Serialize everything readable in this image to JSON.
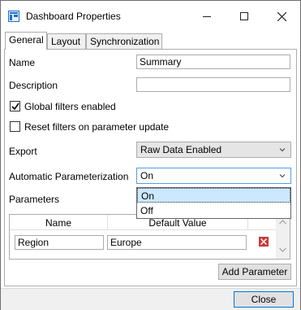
{
  "window": {
    "title": "Dashboard Properties"
  },
  "tabs": [
    {
      "label": "General",
      "active": true
    },
    {
      "label": "Layout",
      "active": false
    },
    {
      "label": "Synchronization",
      "active": false
    }
  ],
  "general": {
    "name_label": "Name",
    "name_value": "Summary",
    "description_label": "Description",
    "description_value": "",
    "global_filters_label": "Global filters enabled",
    "global_filters_checked": true,
    "reset_filters_label": "Reset filters on parameter update",
    "reset_filters_checked": false,
    "export_label": "Export",
    "export_value": "Raw Data Enabled",
    "auto_param_label": "Automatic Parameterization",
    "auto_param_value": "On",
    "auto_param_options": [
      "On",
      "Off"
    ],
    "auto_param_highlighted": "On",
    "parameters_label": "Parameters"
  },
  "parameters_grid": {
    "columns": [
      "Name",
      "Default Value"
    ],
    "rows": [
      {
        "name": "Region",
        "default_value": "Europe"
      }
    ]
  },
  "buttons": {
    "add_parameter": "Add Parameter",
    "close": "Close"
  },
  "colors": {
    "accent": "#0078d7",
    "highlight": "#cce8ff",
    "delete": "#c73b3b"
  }
}
